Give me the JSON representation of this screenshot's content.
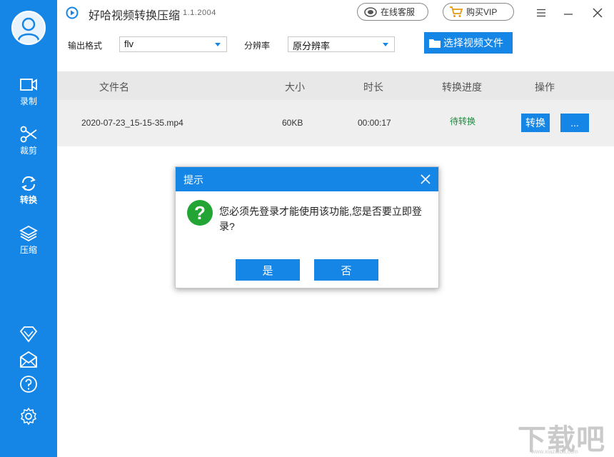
{
  "app": {
    "title": "好哈视频转换压缩",
    "version": "1.1.2004",
    "online_service_label": "在线客服",
    "buy_vip_label": "购买VIP"
  },
  "sidebar": {
    "items": [
      {
        "label": "录制",
        "icon": "video-camera-icon"
      },
      {
        "label": "裁剪",
        "icon": "scissors-icon"
      },
      {
        "label": "转换",
        "icon": "refresh-icon"
      },
      {
        "label": "压缩",
        "icon": "layers-icon"
      }
    ],
    "bottom_icons": [
      "diamond-icon",
      "mail-icon",
      "help-icon",
      "gear-icon"
    ]
  },
  "toolbar": {
    "format_label": "输出格式",
    "format_value": "flv",
    "resolution_label": "分辨率",
    "resolution_value": "原分辨率",
    "choose_file_label": "选择视频文件"
  },
  "table": {
    "headers": [
      "文件名",
      "大小",
      "时长",
      "转换进度",
      "操作"
    ],
    "rows": [
      {
        "filename": "2020-07-23_15-15-35.mp4",
        "size": "60KB",
        "duration": "00:00:17",
        "status": "待转换",
        "convert_label": "转换",
        "more_label": "..."
      }
    ]
  },
  "dialog": {
    "title": "提示",
    "icon": "?",
    "message": "您必须先登录才能使用该功能,您是否要立即登录?",
    "yes_label": "是",
    "no_label": "否"
  },
  "watermark": {
    "text": "下载吧",
    "url": "www.xiazaiba.com"
  },
  "colors": {
    "accent": "#1686e6",
    "status_green": "#1a8b3c",
    "question_green": "#22a534"
  }
}
